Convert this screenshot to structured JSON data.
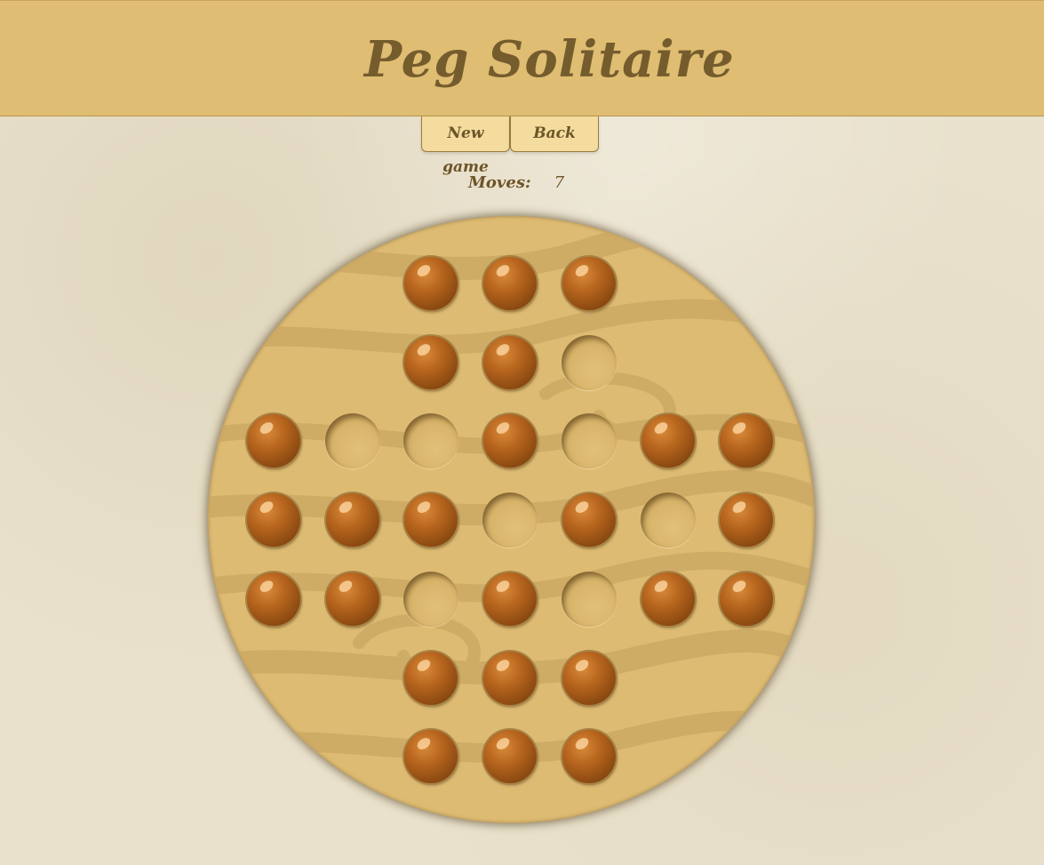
{
  "app": {
    "title": "Peg Solitaire"
  },
  "controls": {
    "new_game_label": "New game",
    "back_label": "Back"
  },
  "status": {
    "moves_label": "Moves:",
    "moves_value": "7"
  },
  "colors": {
    "header": "#dfbd72",
    "background": "#e9e1cc",
    "board": "#ddbb72",
    "peg": "#9b5316",
    "text": "#755c2d"
  },
  "board": {
    "layout": "english-cross-7x7",
    "rows": [
      [
        null,
        null,
        "peg",
        "peg",
        "peg",
        null,
        null
      ],
      [
        null,
        null,
        "peg",
        "peg",
        "empty",
        null,
        null
      ],
      [
        "peg",
        "empty",
        "empty",
        "peg",
        "empty",
        "peg",
        "peg"
      ],
      [
        "peg",
        "peg",
        "peg",
        "empty",
        "peg",
        "empty",
        "peg"
      ],
      [
        "peg",
        "peg",
        "empty",
        "peg",
        "empty",
        "peg",
        "peg"
      ],
      [
        null,
        null,
        "peg",
        "peg",
        "peg",
        null,
        null
      ],
      [
        null,
        null,
        "peg",
        "peg",
        "peg",
        null,
        null
      ]
    ]
  }
}
